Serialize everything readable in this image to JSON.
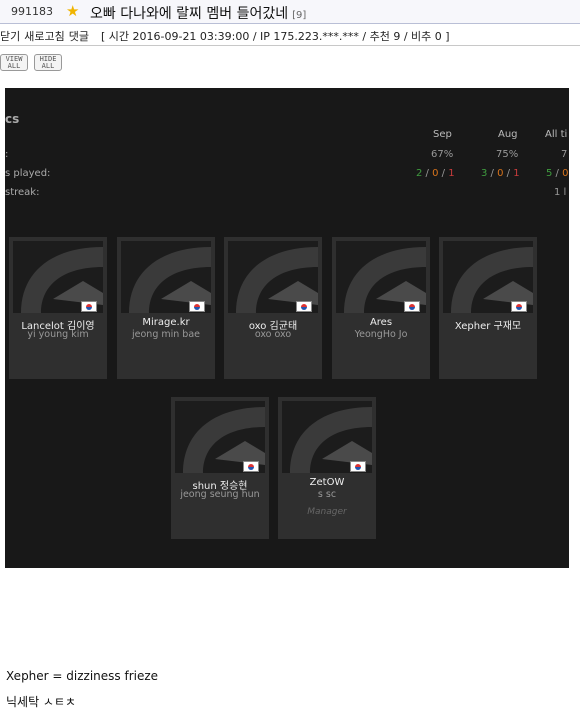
{
  "post": {
    "number": "991183",
    "title": "오빠 다나와에 랄찌 멤버 들어갔네",
    "comment_count": "[9]"
  },
  "meta": {
    "links": [
      "닫기",
      "새로고침",
      "댓글"
    ],
    "info": "[ 시간 2016-09-21 03:39:00 / IP 175.223.***.*** / 추천 9 / 비추 0 ]"
  },
  "controls": {
    "view_all": [
      "VIEW",
      "ALL"
    ],
    "hide_all": [
      "HIDE",
      "ALL"
    ]
  },
  "stats": {
    "section_title": "cs",
    "columns": [
      "Sep",
      "Aug",
      "All ti"
    ],
    "rows": [
      {
        "label": ":",
        "values": [
          "67%",
          "75%",
          "7"
        ]
      },
      {
        "label": "s played:",
        "values": [
          [
            "2",
            "0",
            "1"
          ],
          [
            "3",
            "0",
            "1"
          ],
          [
            "5",
            "0"
          ]
        ]
      },
      {
        "label": "streak:",
        "values": [
          "",
          "",
          "1 l"
        ]
      }
    ]
  },
  "roster": [
    {
      "name": "Lancelot 김이영",
      "real": "yi young kim",
      "role": ""
    },
    {
      "name": "Mirage.kr",
      "real": "jeong min bae",
      "role": ""
    },
    {
      "name": "oxo 김균태",
      "real": "oxo oxo",
      "role": ""
    },
    {
      "name": "Ares",
      "real": "YeongHo Jo",
      "role": ""
    },
    {
      "name": "Xepher 구재모",
      "real": "",
      "role": ""
    },
    {
      "name": "shun 정승현",
      "real": "jeong seung hun",
      "role": ""
    },
    {
      "name": "ZetOW",
      "real": "s sc",
      "role": "Manager"
    }
  ],
  "footer": {
    "line1": "Xepher = dizziness frieze",
    "line2": "닉세탁 ㅅㅌㅊ"
  },
  "colors": {
    "win": "#3f9b3f",
    "draw": "#d8741c",
    "loss": "#c83c3c",
    "panel_bg": "#181818",
    "card_bg": "#2f2f2f"
  }
}
